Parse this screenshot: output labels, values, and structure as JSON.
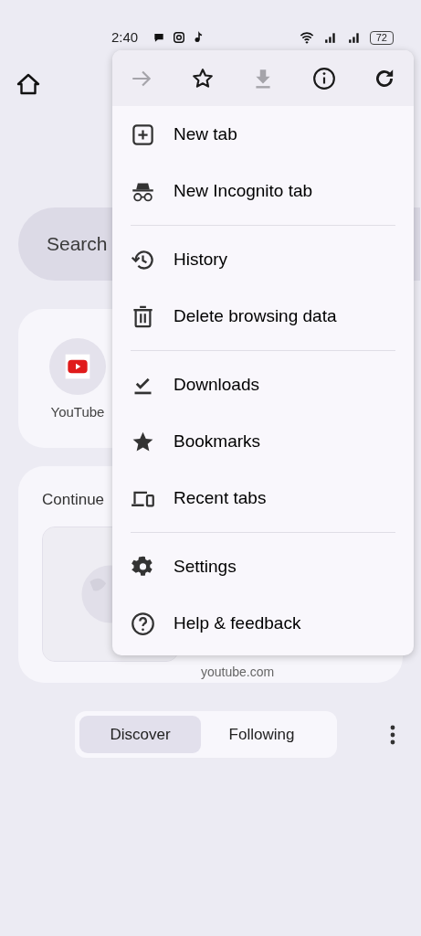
{
  "status_bar": {
    "time": "2:40",
    "battery": "72"
  },
  "search": {
    "placeholder": "Search"
  },
  "shortcuts": [
    {
      "label": "YouTube"
    }
  ],
  "continue_card": {
    "title": "Continue",
    "site": "youtube.com"
  },
  "feed_tabs": [
    {
      "label": "Discover",
      "selected": true
    },
    {
      "label": "Following",
      "selected": false
    }
  ],
  "menu": {
    "toolbar": [
      {
        "kind": "forward",
        "disabled": true
      },
      {
        "kind": "star",
        "disabled": false
      },
      {
        "kind": "download",
        "disabled": true
      },
      {
        "kind": "info",
        "disabled": false
      },
      {
        "kind": "reload",
        "disabled": false
      }
    ],
    "groups": [
      {
        "items": [
          {
            "kind": "newtab",
            "label": "New tab"
          },
          {
            "kind": "incognito",
            "label": "New Incognito tab"
          }
        ]
      },
      {
        "items": [
          {
            "kind": "history",
            "label": "History"
          },
          {
            "kind": "delete",
            "label": "Delete browsing data"
          }
        ]
      },
      {
        "items": [
          {
            "kind": "downloads",
            "label": "Downloads"
          },
          {
            "kind": "bookmarks",
            "label": "Bookmarks"
          },
          {
            "kind": "recent",
            "label": "Recent tabs"
          }
        ]
      },
      {
        "items": [
          {
            "kind": "settings",
            "label": "Settings"
          },
          {
            "kind": "help",
            "label": "Help & feedback"
          }
        ]
      }
    ]
  }
}
